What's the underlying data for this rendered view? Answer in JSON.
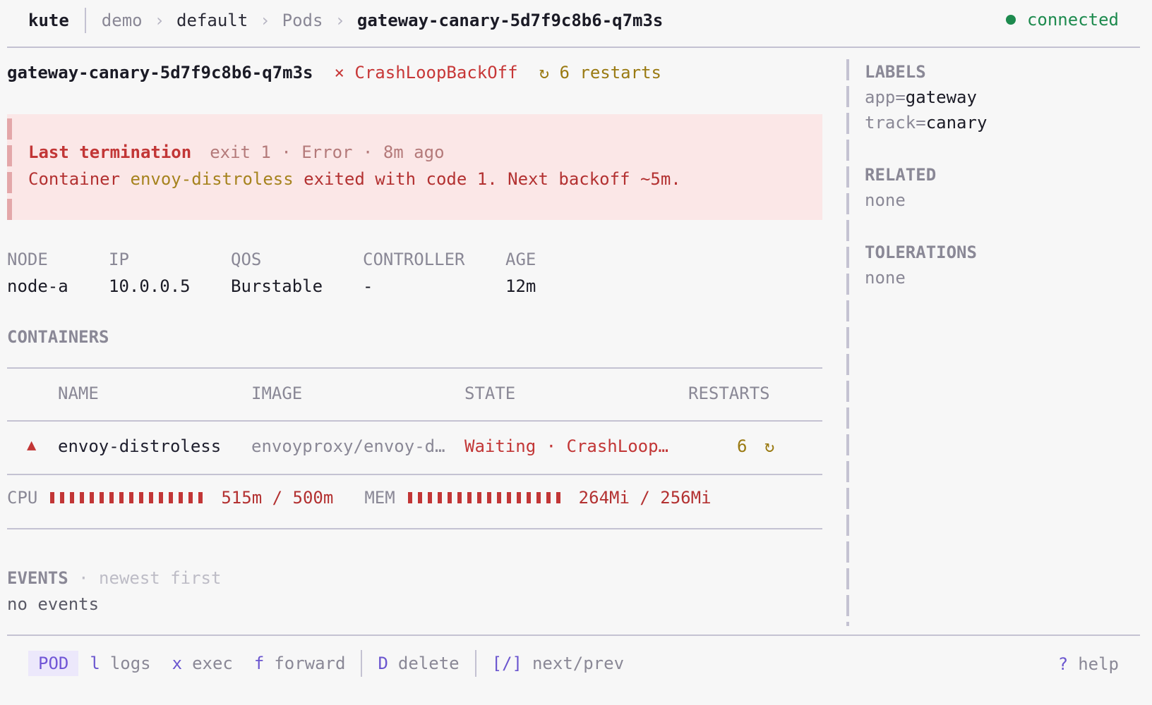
{
  "header": {
    "app_name": "kute",
    "breadcrumbs": [
      "demo",
      "default",
      "Pods",
      "gateway-canary-5d7f9c8b6-q7m3s"
    ],
    "separator": "›",
    "connection": "connected",
    "connection_color": "#1d8a4e"
  },
  "pod": {
    "name": "gateway-canary-5d7f9c8b6-q7m3s",
    "status_icon": "×",
    "status": "CrashLoopBackOff",
    "restarts_icon": "↻",
    "restarts": "6 restarts"
  },
  "alert": {
    "title": "Last termination",
    "meta": "exit 1 · Error · 8m ago",
    "msg_prefix": "Container ",
    "container": "envoy-distroless",
    "msg_suffix": " exited with code 1. Next backoff ~5m."
  },
  "meta": [
    {
      "key": "NODE",
      "value": "node-a"
    },
    {
      "key": "IP",
      "value": "10.0.0.5"
    },
    {
      "key": "QOS",
      "value": "Burstable"
    },
    {
      "key": "CONTROLLER",
      "value": "-"
    },
    {
      "key": "AGE",
      "value": "12m"
    }
  ],
  "containers": {
    "title": "CONTAINERS",
    "columns": [
      "NAME",
      "IMAGE",
      "STATE",
      "RESTARTS"
    ],
    "rows": [
      {
        "icon": "▲",
        "icon_name": "warning-icon",
        "name": "envoy-distroless",
        "image": "envoyproxy/envoy-d…",
        "state": "Waiting · CrashLoop…",
        "restarts": "6",
        "restart_icon": "↻"
      }
    ]
  },
  "resources": {
    "cpu_label": "CPU",
    "cpu_value": "515m / 500m",
    "cpu_fraction": 1.03,
    "mem_label": "MEM",
    "mem_value": "264Mi / 256Mi",
    "mem_fraction": 1.03,
    "bar_color": "#c23636"
  },
  "events": {
    "title": "EVENTS",
    "subtitle": " · newest first",
    "empty": "no events"
  },
  "sidebar": {
    "labels_title": "LABELS",
    "labels": [
      {
        "key": "app=",
        "value": "gateway"
      },
      {
        "key": "track=",
        "value": "canary"
      }
    ],
    "related_title": "RELATED",
    "related_value": "none",
    "tolerations_title": "TOLERATIONS",
    "tolerations_value": "none"
  },
  "footer": {
    "mode": "POD",
    "shortcuts": [
      {
        "key": "l",
        "action": "logs"
      },
      {
        "key": "x",
        "action": "exec"
      },
      {
        "key": "f",
        "action": "forward"
      },
      {
        "key": "D",
        "action": "delete"
      },
      {
        "key": "[/]",
        "action": "next/prev"
      }
    ],
    "help_key": "?",
    "help_action": "help",
    "accent": "#6b56cf"
  }
}
